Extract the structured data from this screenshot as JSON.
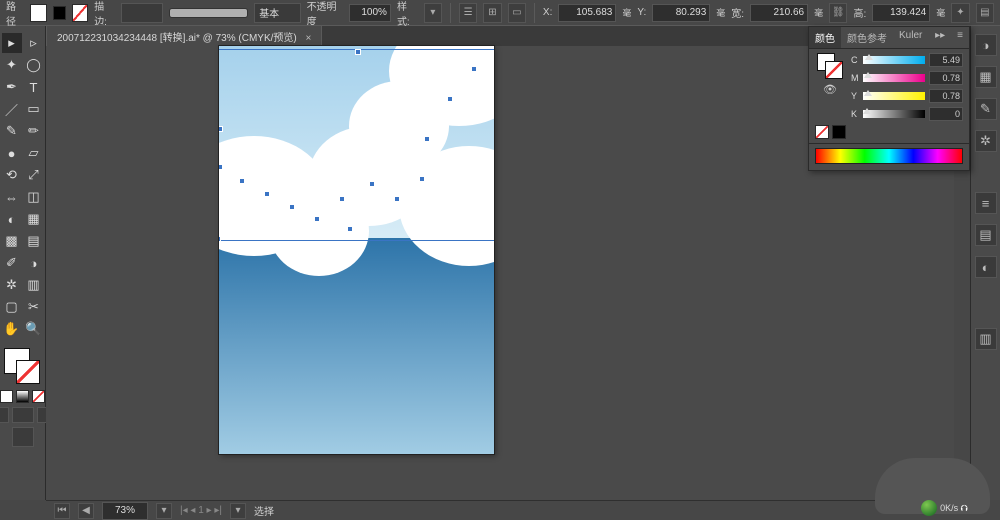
{
  "top": {
    "pathLabel": "路径",
    "strokeLabel": "描边:",
    "strokeWeight": "",
    "styleBtn": "基本",
    "opacityLabel": "不透明度",
    "opacityValue": "100%",
    "styleLabel": "样式:",
    "xLabel": "X:",
    "xVal": "105.683",
    "yLabel": "Y:",
    "yVal": "80.293",
    "wLabel": "宽:",
    "wVal": "210.66",
    "hLabel": "高:",
    "hVal": "139.424",
    "unit": "毫"
  },
  "docTab": {
    "title": "200712231034234448 [转换].ai* @ 73% (CMYK/预览)"
  },
  "status": {
    "zoom": "73%",
    "navLabel": "",
    "mode": "选择"
  },
  "colorPanel": {
    "tabs": [
      "颜色",
      "颜色参考",
      "Kuler"
    ],
    "C": "5.49",
    "M": "0.78",
    "Y": "0.78",
    "K": "0"
  },
  "watermark": {
    "speed": "0K/s"
  }
}
